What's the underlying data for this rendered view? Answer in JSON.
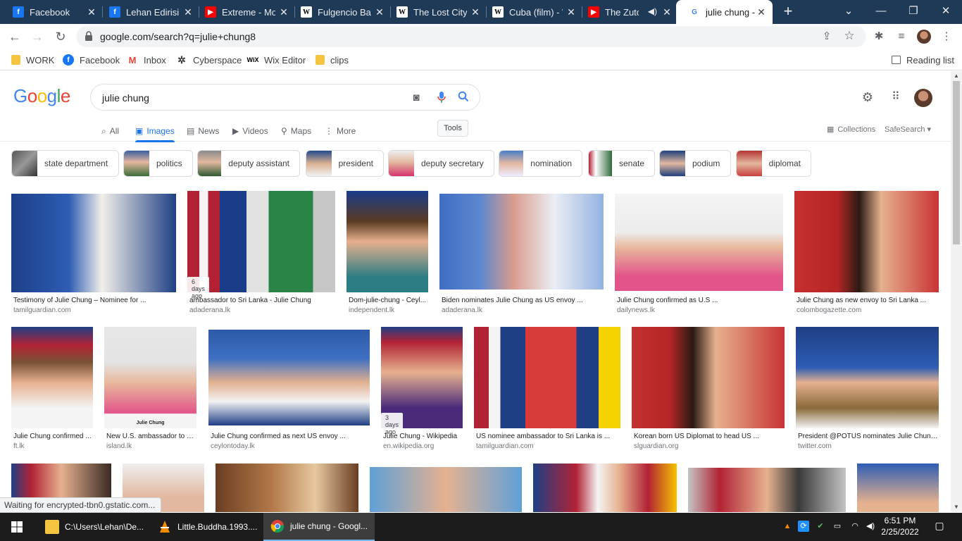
{
  "browser": {
    "tabs": [
      {
        "title": "Facebook",
        "icon": "facebook-icon",
        "kind": "fb"
      },
      {
        "title": "Lehan Edirisin",
        "icon": "facebook-icon",
        "kind": "fb"
      },
      {
        "title": "Extreme - Mo",
        "icon": "youtube-icon",
        "kind": "yt"
      },
      {
        "title": "Fulgencio Bat",
        "icon": "wikipedia-icon",
        "kind": "wk"
      },
      {
        "title": "The Lost City",
        "icon": "wikipedia-icon",
        "kind": "wk"
      },
      {
        "title": "Cuba (film) - W",
        "icon": "wikipedia-icon",
        "kind": "wk"
      },
      {
        "title": "The Zuto",
        "icon": "youtube-icon",
        "kind": "yt",
        "audio": true
      },
      {
        "title": "julie chung -",
        "icon": "google-icon",
        "kind": "gg",
        "active": true
      }
    ],
    "url": "google.com/search?q=julie+chung8",
    "bookmarks": [
      {
        "label": "WORK",
        "icon": "folder-icon"
      },
      {
        "label": "Facebook",
        "icon": "facebook-icon"
      },
      {
        "label": "Inbox",
        "icon": "gmail-icon"
      },
      {
        "label": "Cyberspace",
        "icon": "cyberspace-icon"
      },
      {
        "label": "Wix Editor",
        "icon": "wix-icon"
      },
      {
        "label": "clips",
        "icon": "folder-icon"
      }
    ],
    "reading_list": "Reading list",
    "status": "Waiting for encrypted-tbn0.gstatic.com..."
  },
  "search": {
    "logo": "Google",
    "query": "julie chung",
    "nav": [
      {
        "label": "All",
        "icon": "search-icon"
      },
      {
        "label": "Images",
        "icon": "image-icon",
        "active": true
      },
      {
        "label": "News",
        "icon": "news-icon"
      },
      {
        "label": "Videos",
        "icon": "video-icon"
      },
      {
        "label": "Maps",
        "icon": "map-pin-icon"
      },
      {
        "label": "More",
        "icon": "more-vert-icon"
      }
    ],
    "tools": "Tools",
    "collections": "Collections",
    "safesearch": "SafeSearch ▾",
    "chips": [
      "state department",
      "politics",
      "deputy assistant",
      "president",
      "deputy secretary",
      "nomination",
      "senate",
      "podium",
      "diplomat"
    ],
    "results": [
      {
        "title": "Testimony of Julie Chung – Nominee for ...",
        "source": "tamilguardian.com"
      },
      {
        "title": "ambassador to Sri Lanka - Julie Chung",
        "source": "adaderana.lk",
        "badge": "6 days ago"
      },
      {
        "title": "Dom-julie-chung - Ceyl...",
        "source": "independent.lk"
      },
      {
        "title": "Biden nominates Julie Chung as US envoy ...",
        "source": "adaderana.lk"
      },
      {
        "title": "Julie Chung confirmed as U.S ...",
        "source": "dailynews.lk"
      },
      {
        "title": "Julie Chung as new envoy to Sri Lanka ...",
        "source": "colombogazette.com"
      },
      {
        "title": "Julie Chung confirmed ...",
        "source": "ft.lk"
      },
      {
        "title": "New U.S. ambassador to S...",
        "source": "island.lk",
        "caption": "Julie Chung"
      },
      {
        "title": "Julie Chung confirmed as next US envoy ...",
        "source": "ceylontoday.lk"
      },
      {
        "title": "Julie Chung - Wikipedia",
        "source": "en.wikipedia.org",
        "badge": "3 days ago"
      },
      {
        "title": "US nominee ambassador to Sri Lanka is ...",
        "source": "tamilguardian.com"
      },
      {
        "title": "Korean born US Diplomat to head US ...",
        "source": "slguardian.org"
      },
      {
        "title": "President @POTUS nominates Julie Chung...",
        "source": "twitter.com"
      }
    ]
  },
  "taskbar": {
    "apps": [
      {
        "label": "C:\\Users\\Lehan\\De...",
        "icon": "file-explorer-icon"
      },
      {
        "label": "Little.Buddha.1993....",
        "icon": "vlc-icon"
      },
      {
        "label": "julie chung - Googl...",
        "icon": "chrome-icon",
        "active": true
      }
    ],
    "time": "6:51 PM",
    "date": "2/25/2022"
  }
}
